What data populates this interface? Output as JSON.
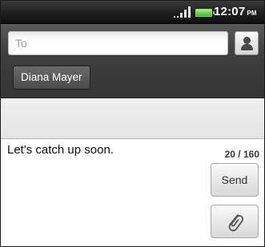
{
  "status_bar": {
    "time": "12:07",
    "ampm": "PM",
    "icons": [
      "signal-icon",
      "battery-icon"
    ],
    "battery_color": "#3fb42d"
  },
  "recipients": {
    "to_placeholder": "To",
    "to_value": "",
    "contact_icon": "person-icon",
    "chips": [
      {
        "name": "Diana Mayer"
      }
    ]
  },
  "compose": {
    "message": "Let's catch up soon.",
    "counter": "20 / 160",
    "send_label": "Send",
    "attach_icon": "paperclip-icon"
  }
}
